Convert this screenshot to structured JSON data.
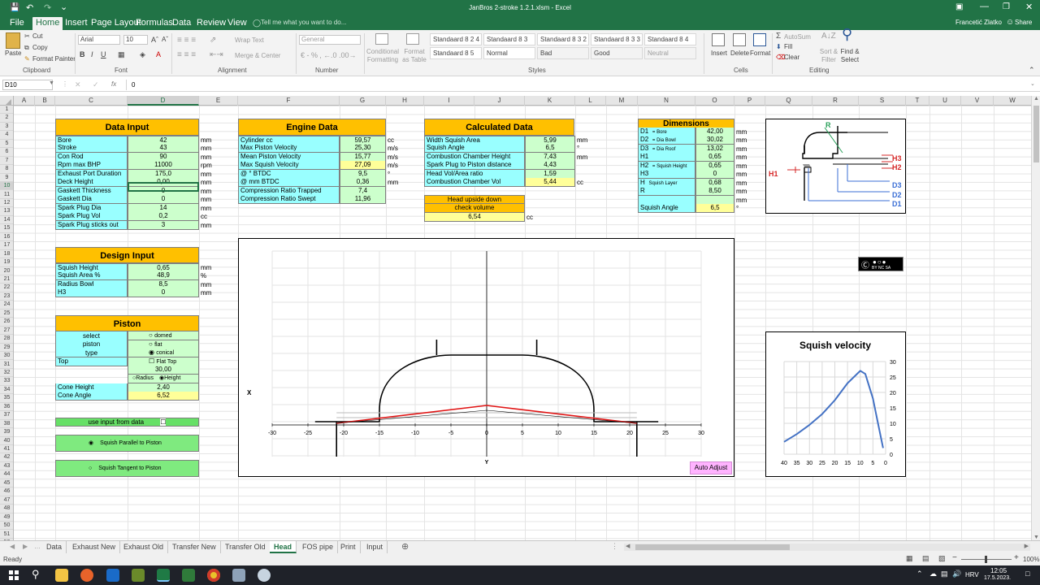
{
  "window": {
    "title": "JanBros 2-stroke 1.2.1.xlsm  -  Excel",
    "user": "Francetić Zlatko",
    "share": "Share"
  },
  "menu": [
    "File",
    "Home",
    "Insert",
    "Page Layout",
    "Formulas",
    "Data",
    "Review",
    "View"
  ],
  "tellme": "Tell me what you want to do...",
  "ribbon": {
    "clipboard": {
      "paste": "Paste",
      "cut": "Cut",
      "copy": "Copy",
      "format_painter": "Format Painter",
      "label": "Clipboard"
    },
    "font": {
      "name": "Arial",
      "size": "10",
      "label": "Font"
    },
    "alignment": {
      "wrap": "Wrap Text",
      "merge": "Merge & Center",
      "label": "Alignment"
    },
    "number": {
      "format": "General",
      "label": "Number"
    },
    "styles": {
      "conditional": "Conditional Formatting",
      "format_table": "Format as Table",
      "cells": [
        "Standaard 8 2 4",
        "Standaard 8 3",
        "Standaard 8 3 2",
        "Standaard 8 3 3",
        "Standaard 8 4",
        "Standaard 8 5",
        "Normal",
        "Bad",
        "Good",
        "Neutral"
      ],
      "label": "Styles"
    },
    "cells": {
      "insert": "Insert",
      "delete": "Delete",
      "format": "Format",
      "label": "Cells"
    },
    "editing": {
      "autosum": "AutoSum",
      "fill": "Fill",
      "clear": "Clear",
      "sort": "Sort & Filter",
      "find": "Find & Select",
      "label": "Editing"
    }
  },
  "formula_bar": {
    "name_box": "D10",
    "fx": "fx",
    "value": "0"
  },
  "columns": [
    "A",
    "B",
    "C",
    "D",
    "E",
    "F",
    "G",
    "H",
    "I",
    "J",
    "K",
    "L",
    "M",
    "N",
    "O",
    "P",
    "Q",
    "R",
    "S",
    "T",
    "U",
    "V",
    "W"
  ],
  "data_input": {
    "title": "Data Input",
    "rows": [
      {
        "label": "Bore",
        "value": "42",
        "unit": "mm"
      },
      {
        "label": "Stroke",
        "value": "43",
        "unit": "mm"
      },
      {
        "label": "Con   Rod",
        "value": "90",
        "unit": "mm"
      },
      {
        "label": "Rpm max BHP",
        "value": "11000",
        "unit": "rpm"
      },
      {
        "label": "Exhaust Port Duration",
        "value": "175,0",
        "unit": "mm"
      },
      {
        "label": "Deck   Height",
        "value": "0,00",
        "unit": "mm"
      },
      {
        "label": "Gaskett   Thickness",
        "value": "0",
        "unit": "mm"
      },
      {
        "label": "Gaskett   Dia",
        "value": "0",
        "unit": "mm"
      },
      {
        "label": "Spark   Plug   Dia",
        "value": "14",
        "unit": "mm"
      },
      {
        "label": "Spark   Plug   Vol",
        "value": "0,2",
        "unit": "cc"
      },
      {
        "label": "Spark Plug sticks out",
        "value": "3",
        "unit": "mm"
      }
    ]
  },
  "engine_data": {
    "title": "Engine Data",
    "rows": [
      {
        "label": "Cylinder   cc",
        "value": "59,57",
        "unit": "cc"
      },
      {
        "label": "Max   Piston   Velocity",
        "value": "25,30",
        "unit": "m/s"
      },
      {
        "label": "Mean   Piston   Velocity",
        "value": "15,77",
        "unit": "m/s"
      },
      {
        "label": "Max  Squish Velocity",
        "value": "27,09",
        "unit": "m/s"
      },
      {
        "label": "@      °     BTDC",
        "value": "9,5",
        "unit": "°"
      },
      {
        "label": "@      mm BTDC",
        "value": "0,36",
        "unit": "mm"
      },
      {
        "label": "Compression   Ratio   Trapped",
        "value": "7,4",
        "unit": ""
      },
      {
        "label": "Compression   Ratio   Swept",
        "value": "11,96",
        "unit": ""
      }
    ]
  },
  "calculated_data": {
    "title": "Calculated Data",
    "rows": [
      {
        "label": "Width   Squish   Area",
        "value": "5,99",
        "unit": "mm"
      },
      {
        "label": "Squish   Angle",
        "value": "6,5",
        "unit": "°"
      },
      {
        "label": "Combustion   Chamber   Height",
        "value": "7,43",
        "unit": "mm"
      },
      {
        "label": "Spark Plug to Piston distance",
        "value": "4,43",
        "unit": ""
      },
      {
        "label": "Head   Vol/Area   ratio",
        "value": "1,59",
        "unit": ""
      },
      {
        "label": "Combustion   Chamber   Vol",
        "value": "5,44",
        "unit": "cc"
      }
    ],
    "upside_label_1": "Head upside down",
    "upside_label_2": "check volume",
    "upside_value": "6,54",
    "upside_unit": "cc"
  },
  "dimensions": {
    "title": "Dimensions",
    "rows": [
      {
        "key": "D1",
        "desc": "= Bore",
        "value": "42,00",
        "unit": "mm"
      },
      {
        "key": "D2",
        "desc": "= Dia Bowl",
        "value": "30,02",
        "unit": "mm"
      },
      {
        "key": "D3",
        "desc": "= Dia Roof",
        "value": "13,02",
        "unit": "mm"
      },
      {
        "key": "H1",
        "desc": "",
        "value": "0,65",
        "unit": "mm"
      },
      {
        "key": "H2",
        "desc": "= Squish Height",
        "value": "0,65",
        "unit": "mm"
      },
      {
        "key": "H3",
        "desc": "",
        "value": "0",
        "unit": "mm"
      },
      {
        "key": "H",
        "desc": "Squish Layer",
        "value": "0,68",
        "unit": "mm"
      },
      {
        "key": "R",
        "desc": "",
        "value": "8,50",
        "unit": "mm"
      },
      {
        "key": "",
        "desc": "",
        "value": "",
        "unit": "mm"
      },
      {
        "key": "Squish Angle",
        "desc": "",
        "value": "6,5",
        "unit": "°"
      }
    ]
  },
  "design_input": {
    "title": "Design Input",
    "rows": [
      {
        "label": "Squish   Height",
        "value": "0,65",
        "unit": "mm"
      },
      {
        "label": "Squish   Area    %",
        "value": "48,9",
        "unit": "%"
      },
      {
        "label": "Radius   Bowl",
        "value": "8,5",
        "unit": "mm"
      },
      {
        "label": "H3",
        "value": "0",
        "unit": "mm"
      }
    ]
  },
  "piston": {
    "title": "Piston",
    "select": [
      "select",
      "piston",
      "type"
    ],
    "options": [
      "domed",
      "flat",
      "conical"
    ],
    "top_label": "Top",
    "flat_top": "Flat Top",
    "top_value": "30,00",
    "radius": "Radius",
    "height": "Height",
    "cone_height_label": "Cone Height",
    "cone_height": "2,40",
    "cone_angle_label": "Cone Angle",
    "cone_angle": "6,52"
  },
  "use_input": "use input from data",
  "squish_parallel": "Squish Parallel to Piston",
  "squish_tangent": "Squish Tangent to Piston",
  "diagram_labels": {
    "R": "R",
    "H1": "H1",
    "H3": "H3",
    "H2": "H2",
    "D3": "D3",
    "D2": "D2",
    "D1": "D1"
  },
  "license": "BY  NC  SA",
  "head_chart": {
    "xlabel": "X",
    "ylabel": "Y",
    "xticks": [
      "-30",
      "-25",
      "-20",
      "-15",
      "-10",
      "-5",
      "0",
      "5",
      "10",
      "15",
      "20",
      "25",
      "30"
    ],
    "button": "Auto Adjust"
  },
  "chart_data": {
    "type": "line",
    "title": "Squish velocity",
    "x": [
      40,
      35,
      30,
      25,
      20,
      15,
      10,
      8,
      5,
      3,
      1
    ],
    "values": [
      4,
      6.5,
      9.5,
      13,
      17.5,
      23,
      27,
      26,
      18,
      10,
      2
    ],
    "xticks": [
      "40",
      "35",
      "30",
      "25",
      "20",
      "15",
      "10",
      "5",
      "0"
    ],
    "yticks": [
      "30",
      "25",
      "20",
      "15",
      "10",
      "5",
      "0"
    ],
    "ylim": [
      0,
      30
    ],
    "xlim": [
      40,
      0
    ],
    "grid": true,
    "color": "#4472c4"
  },
  "sheets": [
    "Data",
    "Exhaust New",
    "Exhaust Old",
    "Transfer New",
    "Transfer Old",
    "Head",
    "FOS pipe",
    "Print",
    "Input"
  ],
  "active_sheet": "Head",
  "status": {
    "ready": "Ready",
    "zoom": "100%"
  },
  "taskbar": {
    "lang": "HRV",
    "time": "12:05",
    "date": "17.5.2023."
  }
}
